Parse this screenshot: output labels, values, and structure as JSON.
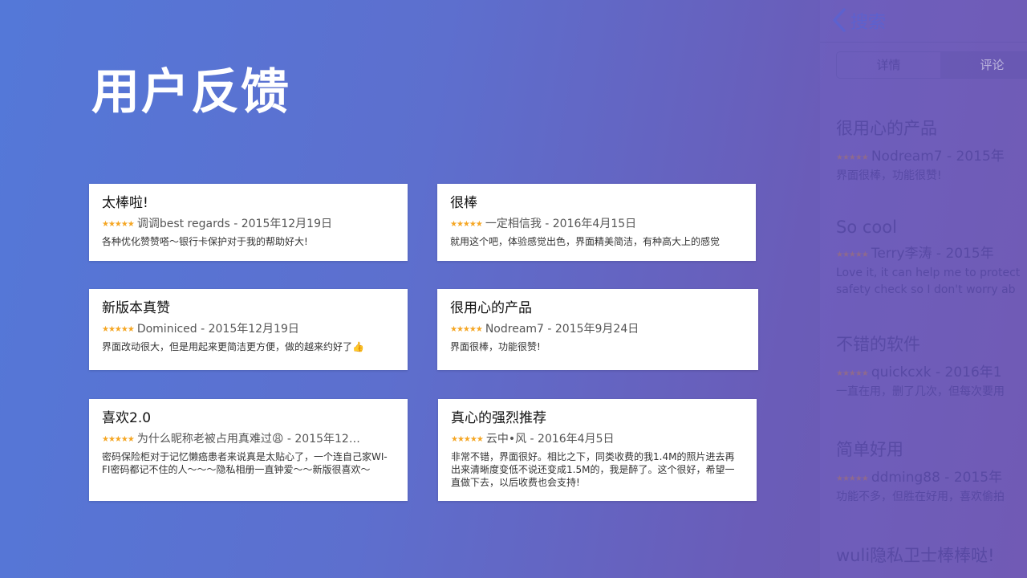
{
  "page": {
    "title": "用户反馈"
  },
  "stars_glyph": "★★★★★",
  "colors": {
    "star": "#f5a623",
    "card_bg": "#ffffff",
    "bg_start": "#5478d8",
    "bg_end": "#6f57ad"
  },
  "reviews": [
    {
      "title": "太棒啦!",
      "meta": "调调best regards - 2015年12月19日",
      "body": "各种优化赞赞嗒～银行卡保护对于我的帮助好大!"
    },
    {
      "title": "很棒",
      "meta": "一定相信我 - 2016年4月15日",
      "body": "就用这个吧，体验感觉出色，界面精美简洁，有种高大上的感觉"
    },
    {
      "title": "新版本真赞",
      "meta": "Dominiced - 2015年12月19日",
      "body": "界面改动很大，但是用起来更简洁更方便，做的越来约好了👍"
    },
    {
      "title": "很用心的产品",
      "meta": "Nodream7 - 2015年9月24日",
      "body": "界面很棒，功能很赞!"
    },
    {
      "title": "喜欢2.0",
      "meta": "为什么昵称老被占用真难过😩 - 2015年12…",
      "body": "密码保险柜对于记忆懒癌患者来说真是太贴心了，一个连自己家WI-FI密码都记不住的人～～～隐私相册一直钟爱～～新版很喜欢～"
    },
    {
      "title": "真心的强烈推荐",
      "meta": "云中•风 - 2016年4月5日",
      "body": "非常不错，界面很好。相比之下，同类收费的我1.4M的照片进去再出来清晰度变低不说还变成1.5M的，我是醉了。这个很好，希望一直做下去，以后收费也会支持!"
    }
  ],
  "side_panel": {
    "back_label": "搜索",
    "segments": [
      "详情",
      "评论"
    ],
    "reviews": [
      {
        "title": "很用心的产品",
        "meta": "Nodream7 - 2015年",
        "body": "界面很棒，功能很赞!"
      },
      {
        "title": "So cool",
        "meta": "Terry李涛 - 2015年",
        "body": "Love it, it can help me to protect",
        "body2": "safety check so I don't worry ab"
      },
      {
        "title": "不错的软件",
        "meta": "quickcxk - 2016年1",
        "body": "一直在用，删了几次，但每次要用"
      },
      {
        "title": "简单好用",
        "meta": "ddming88 - 2015年",
        "body": "功能不多，但胜在好用，喜欢偷拍"
      },
      {
        "title": "wuli隐私卫士棒棒哒!",
        "meta": "",
        "body": ""
      }
    ]
  }
}
